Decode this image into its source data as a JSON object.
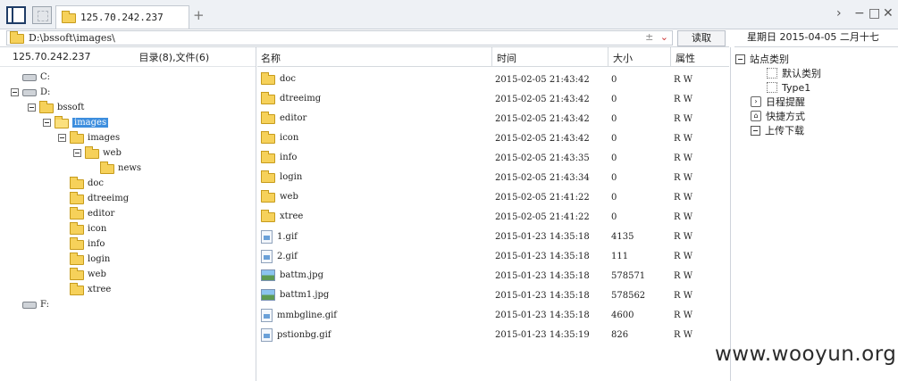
{
  "tab": {
    "title": "125.70.242.237",
    "add_icon": "+"
  },
  "window": {
    "scroll_right": "›",
    "minimize": "−",
    "maximize": "□",
    "close": "✕"
  },
  "path": {
    "value": "D:\\bssoft\\images\\",
    "read_button": "读取",
    "icon_pm": "±",
    "icon_dropdown": "⌄"
  },
  "date_bar": "星期日 2015-04-05 二月十七",
  "left": {
    "host": "125.70.242.237",
    "stats": "目录(8),文件(6)",
    "tree": [
      {
        "label": "C:",
        "type": "drive",
        "level": 0,
        "expander": false
      },
      {
        "label": "D:",
        "type": "drive",
        "level": 0,
        "expander": true
      },
      {
        "label": "bssoft",
        "type": "folder",
        "level": 1,
        "expander": true
      },
      {
        "label": "images",
        "type": "folder-open",
        "level": 2,
        "expander": true,
        "selected": true
      },
      {
        "label": "images",
        "type": "folder",
        "level": 3,
        "expander": true
      },
      {
        "label": "web",
        "type": "folder",
        "level": 4,
        "expander": true
      },
      {
        "label": "news",
        "type": "folder",
        "level": 5,
        "expander": false
      },
      {
        "label": "doc",
        "type": "folder",
        "level": 3,
        "expander": false
      },
      {
        "label": "dtreeimg",
        "type": "folder",
        "level": 3,
        "expander": false
      },
      {
        "label": "editor",
        "type": "folder",
        "level": 3,
        "expander": false
      },
      {
        "label": "icon",
        "type": "folder",
        "level": 3,
        "expander": false
      },
      {
        "label": "info",
        "type": "folder",
        "level": 3,
        "expander": false
      },
      {
        "label": "login",
        "type": "folder",
        "level": 3,
        "expander": false
      },
      {
        "label": "web",
        "type": "folder",
        "level": 3,
        "expander": false
      },
      {
        "label": "xtree",
        "type": "folder",
        "level": 3,
        "expander": false
      },
      {
        "label": "F:",
        "type": "drive",
        "level": 0,
        "expander": false
      }
    ]
  },
  "list": {
    "headers": {
      "name": "名称",
      "time": "时间",
      "size": "大小",
      "attr": "属性"
    },
    "rows": [
      {
        "name": "doc",
        "type": "folder",
        "time": "2015-02-05 21:43:42",
        "size": "0",
        "attr": "R W"
      },
      {
        "name": "dtreeimg",
        "type": "folder",
        "time": "2015-02-05 21:43:42",
        "size": "0",
        "attr": "R W"
      },
      {
        "name": "editor",
        "type": "folder",
        "time": "2015-02-05 21:43:42",
        "size": "0",
        "attr": "R W"
      },
      {
        "name": "icon",
        "type": "folder",
        "time": "2015-02-05 21:43:42",
        "size": "0",
        "attr": "R W"
      },
      {
        "name": "info",
        "type": "folder",
        "time": "2015-02-05 21:43:35",
        "size": "0",
        "attr": "R W"
      },
      {
        "name": "login",
        "type": "folder",
        "time": "2015-02-05 21:43:34",
        "size": "0",
        "attr": "R W"
      },
      {
        "name": "web",
        "type": "folder",
        "time": "2015-02-05 21:41:22",
        "size": "0",
        "attr": "R W"
      },
      {
        "name": "xtree",
        "type": "folder",
        "time": "2015-02-05 21:41:22",
        "size": "0",
        "attr": "R W"
      },
      {
        "name": "1.gif",
        "type": "gif",
        "time": "2015-01-23 14:35:18",
        "size": "4135",
        "attr": "R W"
      },
      {
        "name": "2.gif",
        "type": "gif",
        "time": "2015-01-23 14:35:18",
        "size": "111",
        "attr": "R W"
      },
      {
        "name": "battm.jpg",
        "type": "jpg",
        "time": "2015-01-23 14:35:18",
        "size": "578571",
        "attr": "R W"
      },
      {
        "name": "battm1.jpg",
        "type": "jpg",
        "time": "2015-01-23 14:35:18",
        "size": "578562",
        "attr": "R W"
      },
      {
        "name": "mmbgline.gif",
        "type": "gif",
        "time": "2015-01-23 14:35:18",
        "size": "4600",
        "attr": "R W"
      },
      {
        "name": "pstionbg.gif",
        "type": "gif",
        "time": "2015-01-23 14:35:19",
        "size": "826",
        "attr": "R W"
      }
    ]
  },
  "right": {
    "items": [
      {
        "label": "站点类别",
        "kind": "expander",
        "level": 0
      },
      {
        "label": "默认类别",
        "kind": "dotted",
        "level": 1
      },
      {
        "label": "Type1",
        "kind": "dotted",
        "level": 1
      },
      {
        "label": "日程提醒",
        "kind": "schedule-icon",
        "level": 0
      },
      {
        "label": "快捷方式",
        "kind": "shortcut-icon",
        "level": 0
      },
      {
        "label": "上传下载",
        "kind": "expander",
        "level": 0
      }
    ]
  },
  "watermark": "www.wooyun.org"
}
